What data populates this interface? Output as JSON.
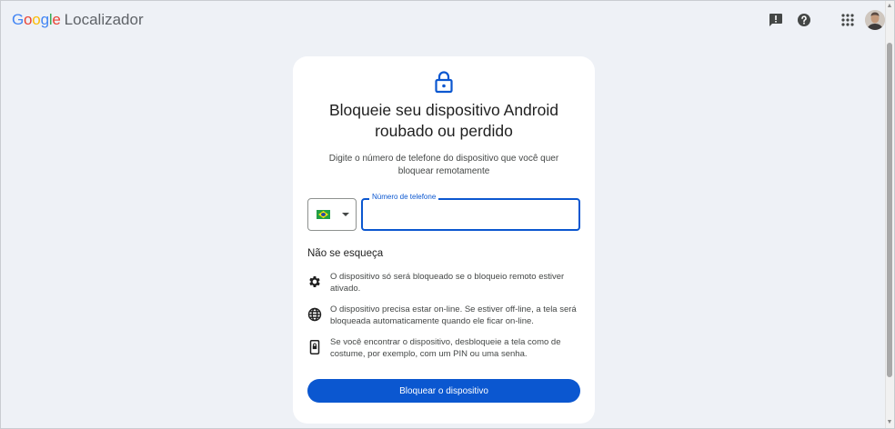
{
  "header": {
    "brand_google": "Google",
    "product_name": "Localizador",
    "icons": [
      "feedback-icon",
      "help-icon",
      "apps-grid-icon"
    ]
  },
  "card": {
    "title": "Bloqueie seu dispositivo Android roubado ou perdido",
    "subtitle": "Digite o número de telefone do dispositivo que você quer bloquear remotamente",
    "country_selected": "Brazil flag",
    "phone_label": "Número de telefone",
    "phone_value": "",
    "remember_heading": "Não se esqueça",
    "tips": [
      {
        "icon": "settings-gear-icon",
        "text": "O dispositivo só será bloqueado se o bloqueio remoto estiver ativado."
      },
      {
        "icon": "globe-icon",
        "text": "O dispositivo precisa estar on-line. Se estiver off-line, a tela será bloqueada automaticamente quando ele ficar on-line."
      },
      {
        "icon": "phone-lock-icon",
        "text": "Se você encontrar o dispositivo, desbloqueie a tela como de costume, por exemplo, com um PIN ou uma senha."
      }
    ],
    "action_label": "Bloquear o dispositivo"
  },
  "colors": {
    "accent": "#0b57d0",
    "page_background": "#eef1f6",
    "card_background": "#ffffff"
  }
}
